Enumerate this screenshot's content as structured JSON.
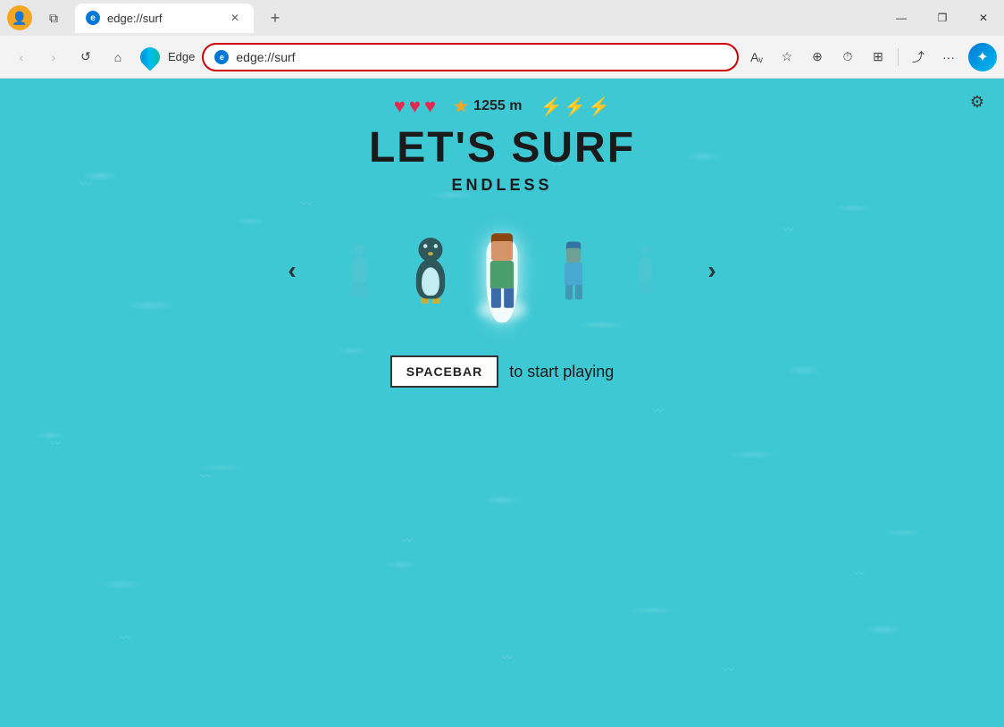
{
  "browser": {
    "tab_title": "edge://surf",
    "tab_favicon": "e",
    "new_tab_label": "+",
    "close_label": "✕",
    "minimize_label": "—",
    "maximize_label": "❐"
  },
  "navbar": {
    "back_label": "‹",
    "forward_label": "›",
    "refresh_label": "↺",
    "home_label": "⌂",
    "edge_brand": "Edge",
    "address": "edge://surf",
    "read_aloud_label": "Aᵥ",
    "favorite_label": "☆",
    "collections_label": "⊕",
    "history_label": "⏱",
    "extensions_label": "⊞",
    "share_label": "⤴",
    "more_label": "···"
  },
  "game": {
    "title": "LET'S SURF",
    "subtitle": "ENDLESS",
    "hearts": [
      "♥",
      "♥",
      "♥"
    ],
    "score_label": "1255 m",
    "spacebar_label": "SPACEBAR",
    "start_label": "to start playing",
    "settings_icon": "⚙",
    "carousel_left": "‹",
    "carousel_right": "›"
  },
  "colors": {
    "ocean": "#3ec8d4",
    "ocean_dark": "#35b5c1",
    "heart_red": "#e5294e",
    "star_gold": "#f5a623",
    "title_dark": "#1a1a1a",
    "bolt_gray": "#555555"
  }
}
